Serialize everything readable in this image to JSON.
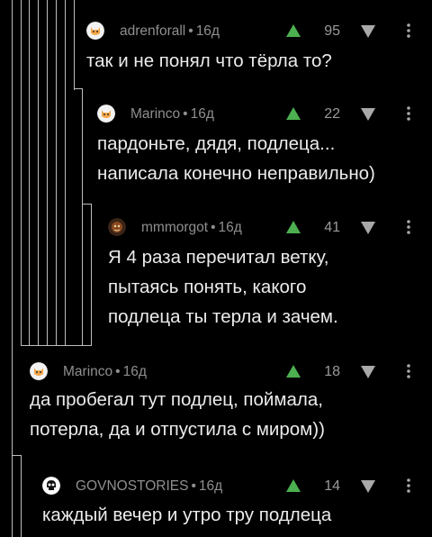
{
  "colors": {
    "background": "#000000",
    "upvote": "#4caf50",
    "downvote": "#a9a9a9",
    "thread_line": "#bdbdbd",
    "text": "#ececec",
    "meta_text": "#8f8f8f"
  },
  "comments": [
    {
      "avatar_icon": "cat-face-avatar-icon",
      "author": "adrenforall",
      "separator": "•",
      "time": "16д",
      "score": "95",
      "lines": [
        "так и не понял что тёрла то?"
      ]
    },
    {
      "avatar_icon": "cat-face-avatar-icon",
      "author": "Marinco",
      "separator": "•",
      "time": "16д",
      "score": "22",
      "lines": [
        "пардоньте, дядя, подлеца...",
        "написала конечно неправильно)"
      ]
    },
    {
      "avatar_icon": "dark-face-avatar-icon",
      "author": "mmmorgot",
      "separator": "•",
      "time": "16д",
      "score": "41",
      "lines": [
        "Я 4 раза перечитал ветку,",
        "пытаясь понять, какого",
        "подлеца ты терла и зачем."
      ]
    },
    {
      "avatar_icon": "cat-face-avatar-icon",
      "author": "Marinco",
      "separator": "•",
      "time": "16д",
      "score": "18",
      "lines": [
        "да пробегал тут подлец, поймала,",
        "потерла, да и отпустила с миром))"
      ]
    },
    {
      "avatar_icon": "skull-avatar-icon",
      "author": "GOVNOSTORIES",
      "separator": "•",
      "time": "16д",
      "score": "14",
      "lines": [
        "каждый вечер и утро тру подлеца"
      ]
    }
  ]
}
